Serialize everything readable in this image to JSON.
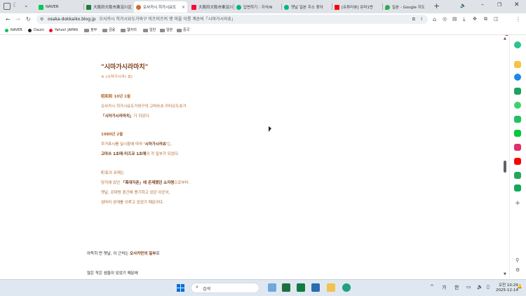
{
  "tabs": [
    {
      "label": "NAVER",
      "color": "#03c75a"
    },
    {
      "label": "大阪府大阪市東淀川区",
      "color": "#1a7f37"
    },
    {
      "label": "오사카시 히가시요도",
      "color": "#d2692c"
    },
    {
      "label": "大阪府大阪市東淀川区",
      "color": "#ff0033"
    },
    {
      "label": "답변하기 : 지식iN",
      "color": "#00b388"
    },
    {
      "label": "옛날 일본 주소 찾아",
      "color": "#00b388"
    },
    {
      "label": "[유튜터뷰] 유머1번",
      "color": "#ff0000"
    },
    {
      "label": "일본 - Google 지도",
      "color": "#34a853"
    }
  ],
  "address": {
    "url": "osaka-dokkaiko.blog.jp",
    "title": "오사카시 히가시요도가와구 미즈미즈의 옛 마을 이름 계승비「시마가시라쵸」"
  },
  "bookmarks": [
    {
      "label": "NAVER",
      "color": "#03c75a"
    },
    {
      "label": "Daum",
      "color": "#222222"
    },
    {
      "label": "Yahoo! JAPAN",
      "color": "#ff0033"
    },
    {
      "label": "정부"
    },
    {
      "label": "금융"
    },
    {
      "label": "웹자리"
    },
    {
      "label": "일반"
    },
    {
      "label": "일본"
    },
    {
      "label": "중국"
    }
  ],
  "article": {
    "heading": "\"시마가시라마치\"",
    "sub": "※ (시마가시라) 쵸)",
    "p1_date": "昭和和 10년 1월",
    "p1_l1": "오사카시 히가시요도가와구의 고마쓰초·카타오도초가",
    "p1_l2_bold": "「시마가시라마치」",
    "p1_l2_rest": "가 되었다.",
    "p2_date": "1980년 2월",
    "p2_l1_a": "주거표시를 실시함에 따라 ",
    "p2_l1_bold": "'시마가시라쵸'",
    "p2_l1_b": "는,",
    "p2_l2_bold": "고마쓰 1초메·미즈코 1초메",
    "p2_l2_rest": "의 각 일부가 되었다.",
    "p3_l1": "町名의 유래는",
    "p3_l2_a": "당지에 있던 ",
    "p3_l2_bold": "「흑대자촌」에 존재했던 소자명",
    "p3_l2_b": "으로부터.",
    "p3_l3": "옛날, 강대방 중간에 용기하고 있던 이곳이,",
    "p3_l4": "섬머리 상태를 이루고 있었기 때문이다.",
    "q1_a": "아득히 먼 옛날, 이 근처는 ",
    "q1_bold": "오사카만의 일부",
    "q1_b": "로",
    "q2": "많은 작은 섬들이 있었기 때문에"
  },
  "taskbar": {
    "search_placeholder": "검색",
    "time": "오전 10:29",
    "date": "2025-12-14",
    "ime1": "가",
    "ime2": "한"
  },
  "colors": {
    "accent": "#b2662c",
    "tabbar": "#dfe3e8",
    "taskbar": "#dfe8f0"
  }
}
